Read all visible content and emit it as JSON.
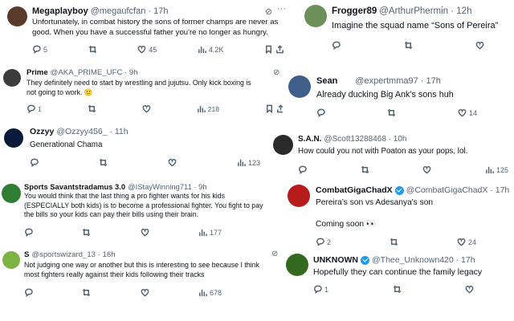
{
  "tweets": [
    {
      "name": "Megaplayboy",
      "handle": "@megaufcfan · 17h",
      "verified": false,
      "grok": true,
      "lines": [
        "Unfortunately, in combat history the sons of former champs are never as",
        "good. When you have a successful father you're no longer as hungry."
      ],
      "stats": {
        "reply": "5",
        "retweet": "",
        "like": "45",
        "views": "4.2K"
      },
      "avatar_color": "#5a3a2a"
    },
    {
      "name": "Prime",
      "handle": "@AKA_PRIME_UFC · 9h",
      "verified": false,
      "grok": true,
      "lines": [
        "They definitely need to start by wrestling and jujutsu. Only kick boxing is",
        "not going to work. 🙂"
      ],
      "stats": {
        "reply": "1",
        "retweet": "",
        "like": "",
        "views": "218"
      },
      "avatar_color": "#3b3b3b"
    },
    {
      "name": "Ozzyy",
      "handle": "@Ozzyy456_ · 11h",
      "verified": false,
      "grok": false,
      "lines": [
        "Generational Chama"
      ],
      "stats": {
        "reply": "",
        "retweet": "",
        "like": "",
        "views": "123"
      },
      "avatar_color": "#0a1a3a"
    },
    {
      "name": "Sports Savantstradamus 3.0",
      "handle": "@IStayWinning711 · 9h",
      "verified": false,
      "grok": false,
      "lines": [
        "You would think that the last thing a pro fighter wants for his kids",
        "(ESPECIALLY both kids) is to become a professional fighter. You fight to pay",
        "the bills so your kids can pay their bills using their brain."
      ],
      "stats": {
        "reply": "",
        "retweet": "",
        "like": "",
        "views": "177"
      },
      "avatar_color": "#2e7d32"
    },
    {
      "name": "S",
      "handle": "@sportswizard_13 · 16h",
      "verified": false,
      "grok": true,
      "lines": [
        "Not judging one way or another but this is interesting to see because I think",
        "most fighters really against their kids following their tracks"
      ],
      "stats": {
        "reply": "",
        "retweet": "",
        "like": "",
        "views": "678"
      },
      "avatar_color": "#7cb342"
    },
    {
      "name": "Frogger89",
      "handle": "@ArthurPhermin · 12h",
      "verified": false,
      "grok": false,
      "lines": [
        "Imagine the squad name “Sons of Pereira”"
      ],
      "stats": {
        "reply": "",
        "retweet": "",
        "like": "",
        "views": ""
      },
      "avatar_color": "#6d8f5a"
    },
    {
      "name": "Sean",
      "handle": "@expertmma97 · 17h",
      "verified": false,
      "grok": false,
      "lines": [
        "Already ducking Big Ank's sons huh"
      ],
      "stats": {
        "reply": "",
        "retweet": "",
        "like": "14",
        "views": ""
      },
      "avatar_color": "#3f5f8a"
    },
    {
      "name": "S.A.N.",
      "handle": "@Scott13288468 · 10h",
      "verified": false,
      "grok": false,
      "lines": [
        "How could you not with Poaton as your pops, lol."
      ],
      "stats": {
        "reply": "",
        "retweet": "",
        "like": "",
        "views": "125"
      },
      "avatar_color": "#2a2a2a"
    },
    {
      "name": "CombatGigaChadX",
      "handle": "@CombatGigaChadX · 17h",
      "verified": true,
      "grok": false,
      "lines": [
        "Pereira's son vs Adesanya's son",
        "",
        "Coming soon 👀"
      ],
      "stats": {
        "reply": "2",
        "retweet": "",
        "like": "24",
        "views": ""
      },
      "avatar_color": "#b71c1c"
    },
    {
      "name": "UNKNOWN",
      "handle": "@Thee_Unknown420 · 17h",
      "verified": true,
      "grok": false,
      "lines": [
        "Hopefully they can continue the family legacy"
      ],
      "stats": {
        "reply": "1",
        "retweet": "",
        "like": "",
        "views": ""
      },
      "avatar_color": "#33691e"
    }
  ]
}
